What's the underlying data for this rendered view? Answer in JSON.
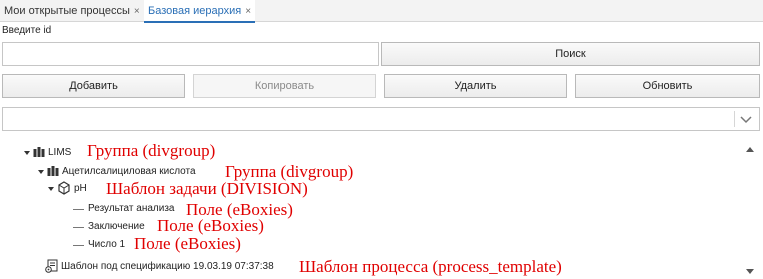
{
  "tabs": [
    {
      "label": "Мои открытые процессы",
      "close": "×"
    },
    {
      "label": "Базовая иерархия",
      "close": "×"
    }
  ],
  "search": {
    "label": "Введите id",
    "value": "",
    "placeholder": "",
    "button": "Поиск"
  },
  "toolbar": {
    "add": "Добавить",
    "copy": "Копировать",
    "delete": "Удалить",
    "refresh": "Обновить"
  },
  "combo": {
    "value": ""
  },
  "tree": {
    "lims": {
      "label": "LIMS",
      "annotation": "Группа  (divgroup)"
    },
    "acid": {
      "label": "Ацетилсалициловая кислота",
      "annotation": "Группа  (divgroup)"
    },
    "ph": {
      "label": "pH",
      "annotation": "Шаблон задачи (DIVISION)"
    },
    "result": {
      "label": "Результат анализа",
      "annotation": "Поле (eBoxies)"
    },
    "conclusion": {
      "label": "Заключение",
      "annotation": "Поле (eBoxies)"
    },
    "number": {
      "label": "Число 1",
      "annotation": "Поле (eBoxies)"
    },
    "template": {
      "label": "Шаблон под спецификацию 19.03.19 07:37:38",
      "annotation": "Шаблон процесса (process_template)"
    }
  },
  "colors": {
    "accent": "#2a6fb6",
    "annotation": "#e00000"
  }
}
